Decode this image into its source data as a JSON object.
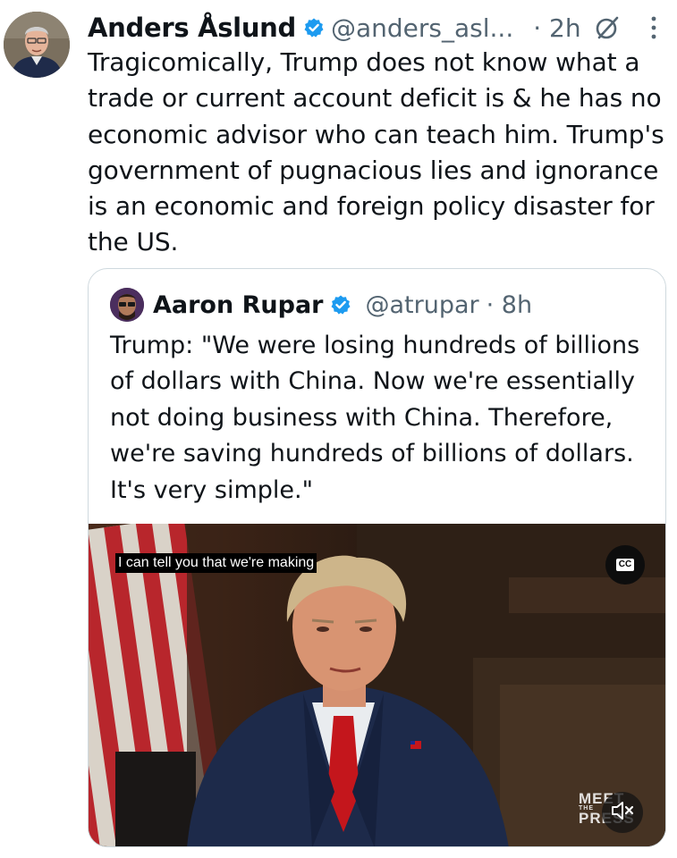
{
  "tweet": {
    "author_name": "Anders Åslund",
    "handle": "@anders_asl...",
    "time": "· 2h",
    "text": "Tragicomically, Trump does not know what a trade or current account deficit is & he has no economic advisor who can teach him. Trump's government of pugnacious lies and ignorance is an economic and foreign policy disaster for the US."
  },
  "quote": {
    "author_name": "Aaron Rupar",
    "handle": "@atrupar",
    "time": "· 8h",
    "text": "Trump: \"We were losing hundreds of billions of dollars with China. Now we're essentially not doing business with China. Therefore, we're saving hundreds of billions of dollars. It's very simple.\""
  },
  "video": {
    "caption": "I can tell you that we're making",
    "cc_label": "CC",
    "watermark_top": "MEET",
    "watermark_small": "THE",
    "watermark_bottom": "PRESS"
  },
  "icons": {
    "verified": "verified-badge-icon",
    "grok": "grok-icon",
    "more": "more-vertical-icon",
    "mute": "muted-speaker-icon"
  },
  "colors": {
    "verified_blue": "#1d9bf0",
    "secondary_text": "#536471",
    "border": "#cfd9de"
  }
}
